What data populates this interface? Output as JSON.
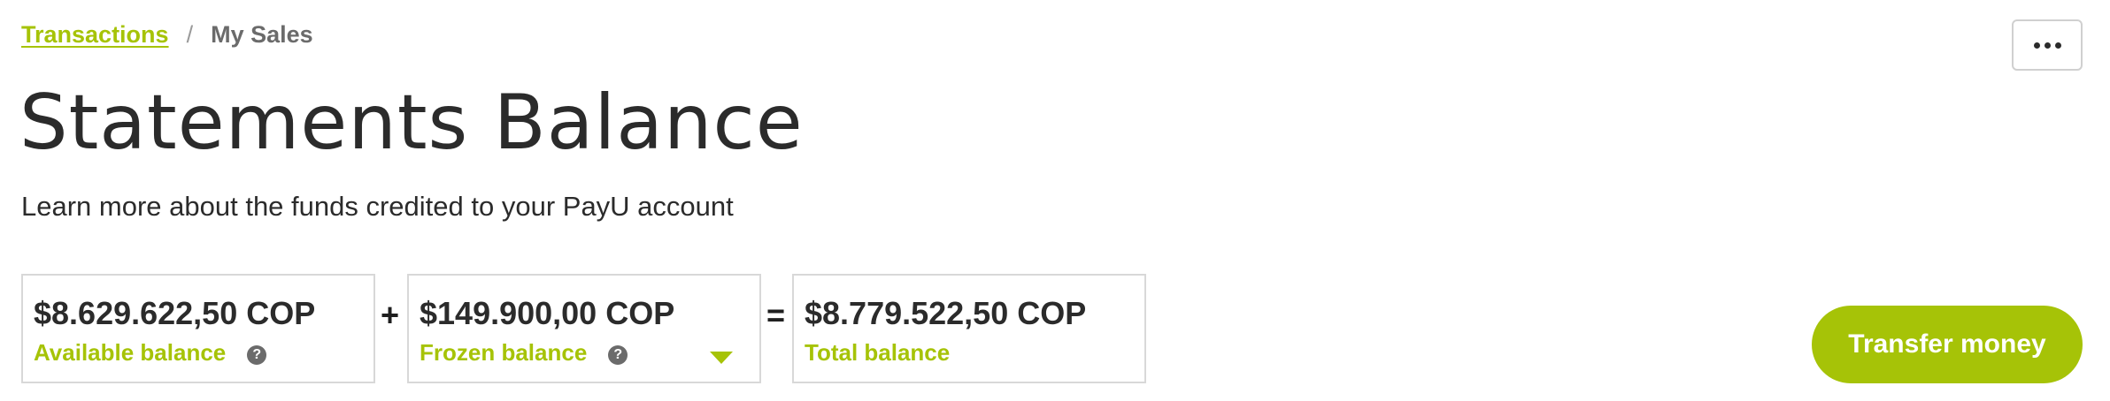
{
  "breadcrumb": {
    "link": "Transactions",
    "separator": "/",
    "current": "My Sales"
  },
  "page": {
    "title": "Statements Balance",
    "subtitle": "Learn more about the funds credited to your PayU account"
  },
  "balances": {
    "available": {
      "amount": "$8.629.622,50 COP",
      "label": "Available balance",
      "help": "?"
    },
    "operator_plus": "+",
    "frozen": {
      "amount": "$149.900,00 COP",
      "label": "Frozen balance",
      "help": "?"
    },
    "operator_equals": "=",
    "total": {
      "amount": "$8.779.522,50 COP",
      "label": "Total balance"
    }
  },
  "actions": {
    "transfer_label": "Transfer money"
  },
  "icons": {
    "more": "more-horizontal-icon",
    "help": "question-circle-icon",
    "expand": "caret-down-icon"
  },
  "colors": {
    "accent": "#a6c307",
    "text": "#2b2b2b",
    "muted": "#6b6b6b",
    "border": "#d8d8d8"
  }
}
